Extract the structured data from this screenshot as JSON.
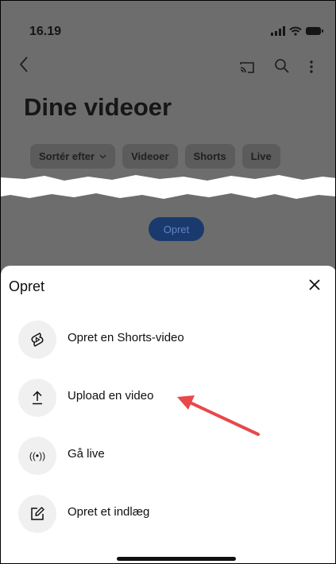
{
  "status": {
    "time": "16.19"
  },
  "page": {
    "title": "Dine videoer",
    "chips": [
      {
        "label": "Sortér efter",
        "has_dropdown": true
      },
      {
        "label": "Videoer"
      },
      {
        "label": "Shorts"
      },
      {
        "label": "Live"
      }
    ],
    "create_button": "Opret"
  },
  "sheet": {
    "title": "Opret",
    "items": [
      {
        "label": "Opret en Shorts-video",
        "icon": "shorts-icon"
      },
      {
        "label": "Upload en video",
        "icon": "upload-icon"
      },
      {
        "label": "Gå live",
        "icon": "live-icon",
        "icon_text": "((•))"
      },
      {
        "label": "Opret et indlæg",
        "icon": "edit-post-icon"
      }
    ]
  },
  "colors": {
    "annotation_arrow": "#e8484a",
    "create_button_bg": "#1a3a6e",
    "sheet_bg": "#ffffff",
    "overlay_bg": "#6d6d6d"
  }
}
